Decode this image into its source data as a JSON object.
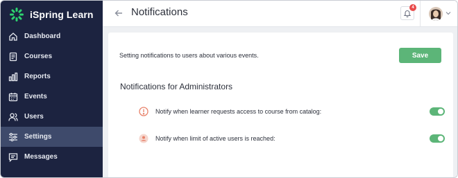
{
  "app": {
    "brand_name": "iSpring Learn",
    "brand_color": "#2dd36f"
  },
  "sidebar": {
    "items": [
      {
        "label": "Dashboard",
        "icon": "home-icon",
        "active": false
      },
      {
        "label": "Courses",
        "icon": "courses-icon",
        "active": false
      },
      {
        "label": "Reports",
        "icon": "bar-chart-icon",
        "active": false
      },
      {
        "label": "Events",
        "icon": "calendar-icon",
        "active": false
      },
      {
        "label": "Users",
        "icon": "users-icon",
        "active": false
      },
      {
        "label": "Settings",
        "icon": "sliders-icon",
        "active": true
      },
      {
        "label": "Messages",
        "icon": "message-icon",
        "active": false
      }
    ]
  },
  "header": {
    "title": "Notifications",
    "notification_count": "4"
  },
  "main": {
    "description": "Setting notifications to users about various events.",
    "save_label": "Save",
    "section_title": "Notifications for Administrators",
    "notifications": [
      {
        "text": "Notify when learner requests access to course from catalog:",
        "icon": "exclamation-circle-icon",
        "enabled": true
      },
      {
        "text": "Notify when limit of active users is reached:",
        "icon": "user-circle-icon",
        "enabled": true
      }
    ]
  },
  "colors": {
    "sidebar_bg": "#1c2340",
    "sidebar_active": "#3e4a6b",
    "accent_green": "#5cb578",
    "badge_red": "#e94b4b",
    "warning_orange": "#e8826a"
  }
}
